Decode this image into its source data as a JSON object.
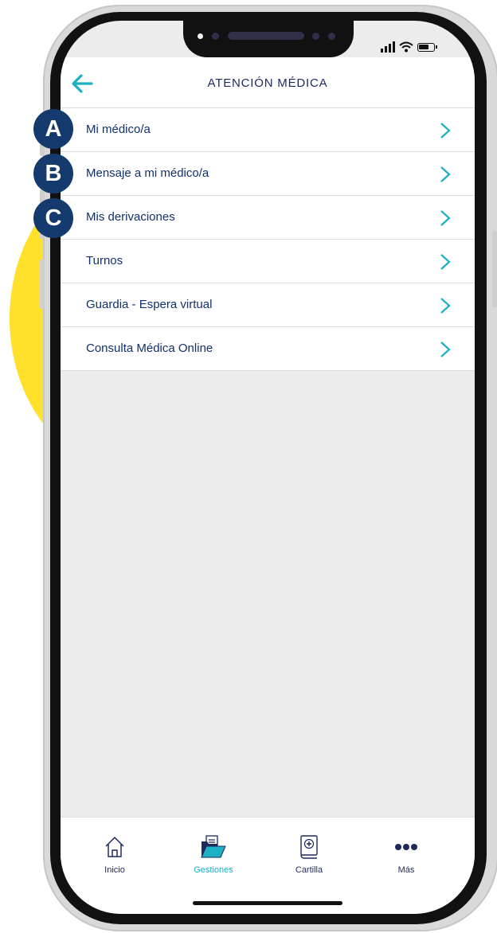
{
  "header": {
    "title": "ATENCIÓN MÉDICA",
    "back_icon": "arrow-left-icon"
  },
  "menu": {
    "items": [
      {
        "label": "Mi médico/a",
        "badge": "A"
      },
      {
        "label": "Mensaje a mi médico/a",
        "badge": "B"
      },
      {
        "label": "Mis derivaciones",
        "badge": "C"
      },
      {
        "label": "Turnos",
        "badge": ""
      },
      {
        "label": "Guardia - Espera virtual",
        "badge": ""
      },
      {
        "label": "Consulta Médica Online",
        "badge": ""
      }
    ]
  },
  "tabbar": {
    "active": "Gestiones",
    "items": [
      {
        "label": "Inicio",
        "icon": "home-icon"
      },
      {
        "label": "Gestiones",
        "icon": "folder-icon"
      },
      {
        "label": "Cartilla",
        "icon": "medical-book-icon"
      },
      {
        "label": "Más",
        "icon": "more-dots-icon"
      }
    ]
  },
  "colors": {
    "accent_teal": "#1bb0c4",
    "navy_text": "#12316a",
    "badge_navy": "#153a6e",
    "yellow": "#ffe02a",
    "screen_bg": "#ececec"
  }
}
